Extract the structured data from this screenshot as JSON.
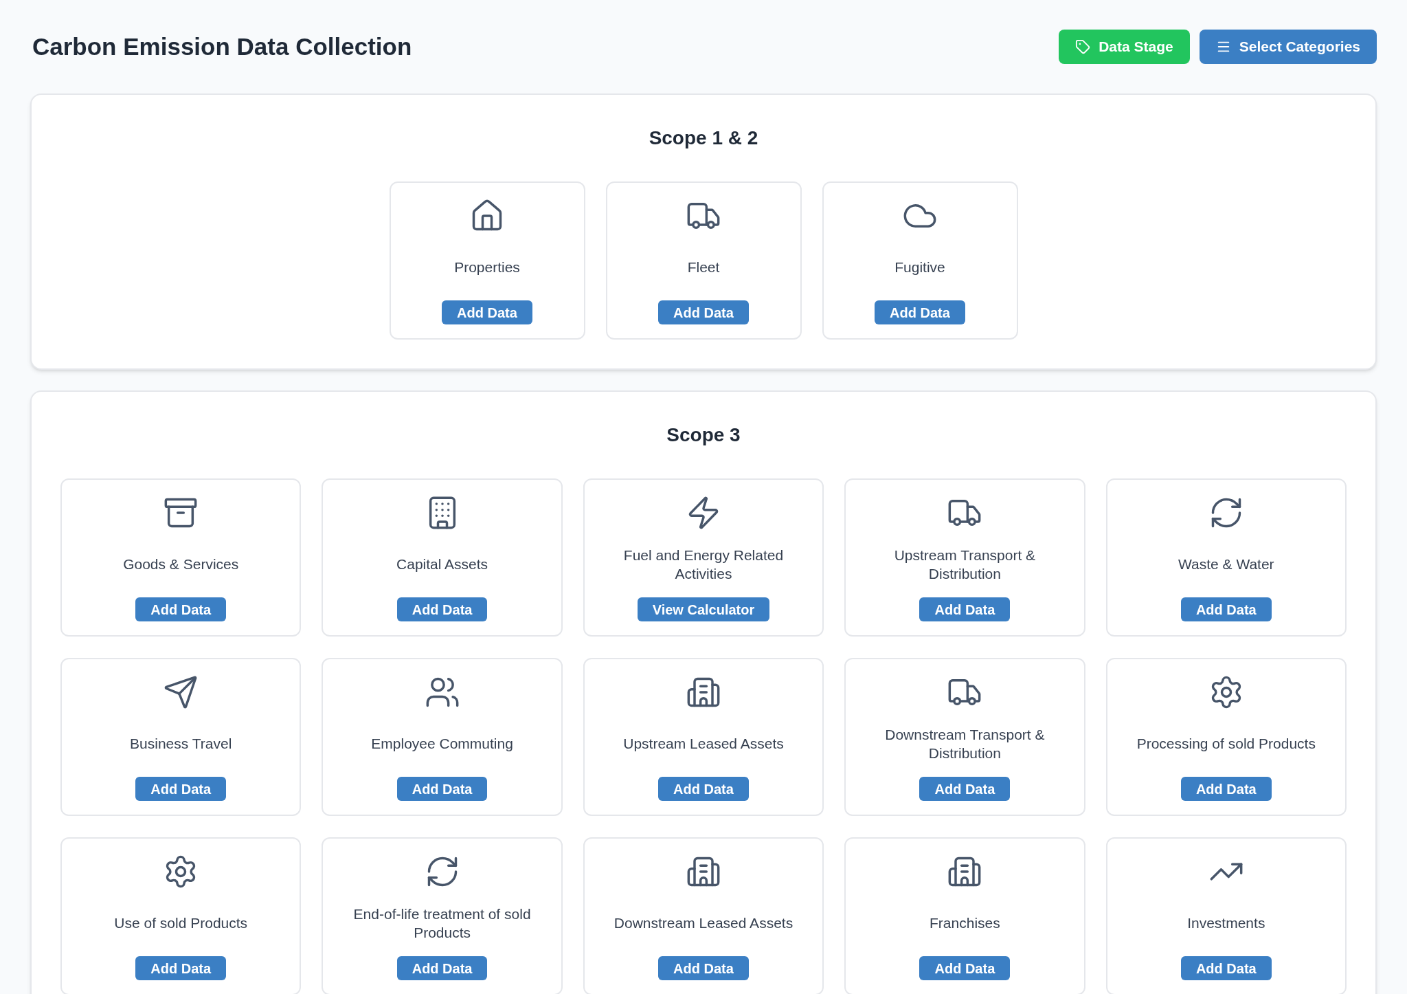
{
  "header": {
    "title": "Carbon Emission Data Collection",
    "buttons": [
      {
        "label": "Data Stage",
        "kind": "stage"
      },
      {
        "label": "Select Categories",
        "kind": "categories"
      }
    ]
  },
  "sections": [
    {
      "title": "Scope 1 & 2",
      "cards": [
        {
          "label": "Properties",
          "action": "Add Data"
        },
        {
          "label": "Fleet",
          "action": "Add Data"
        },
        {
          "label": "Fugitive",
          "action": "Add Data"
        }
      ]
    },
    {
      "title": "Scope 3",
      "cards": [
        {
          "label": "Goods & Services",
          "action": "Add Data"
        },
        {
          "label": "Capital Assets",
          "action": "Add Data"
        },
        {
          "label": "Fuel and Energy Related Activities",
          "action": "View Calculator"
        },
        {
          "label": "Upstream Transport & Distribution",
          "action": "Add Data"
        },
        {
          "label": "Waste & Water",
          "action": "Add Data"
        },
        {
          "label": "Business Travel",
          "action": "Add Data"
        },
        {
          "label": "Employee Commuting",
          "action": "Add Data"
        },
        {
          "label": "Upstream Leased Assets",
          "action": "Add Data"
        },
        {
          "label": "Downstream Transport & Distribution",
          "action": "Add Data"
        },
        {
          "label": "Processing of sold Products",
          "action": "Add Data"
        },
        {
          "label": "Use of sold Products",
          "action": "Add Data"
        },
        {
          "label": "End-of-life treatment of sold Products",
          "action": "Add Data"
        },
        {
          "label": "Downstream Leased Assets",
          "action": "Add Data"
        },
        {
          "label": "Franchises",
          "action": "Add Data"
        },
        {
          "label": "Investments",
          "action": "Add Data"
        }
      ]
    }
  ]
}
